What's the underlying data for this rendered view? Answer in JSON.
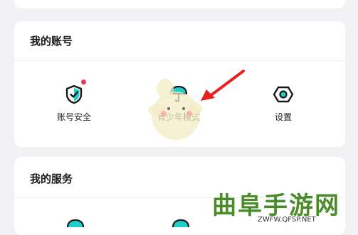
{
  "account_section": {
    "title": "我的账号",
    "items": [
      {
        "label": "账号安全",
        "icon": "shield-check-icon",
        "badge_color": "#f0305a"
      },
      {
        "label": "青少年模式",
        "icon": "umbrella-icon"
      },
      {
        "label": "设置",
        "icon": "hexagon-gear-icon"
      }
    ]
  },
  "services_section": {
    "title": "我的服务"
  },
  "watermark": {
    "title": "曲阜手游网",
    "url": "ZWFW.QFSP.NET"
  },
  "colors": {
    "accent": "#1fcfc6",
    "icon_dark": "#1a1a1a",
    "badge": "#f0305a",
    "arrow": "#e82020"
  }
}
